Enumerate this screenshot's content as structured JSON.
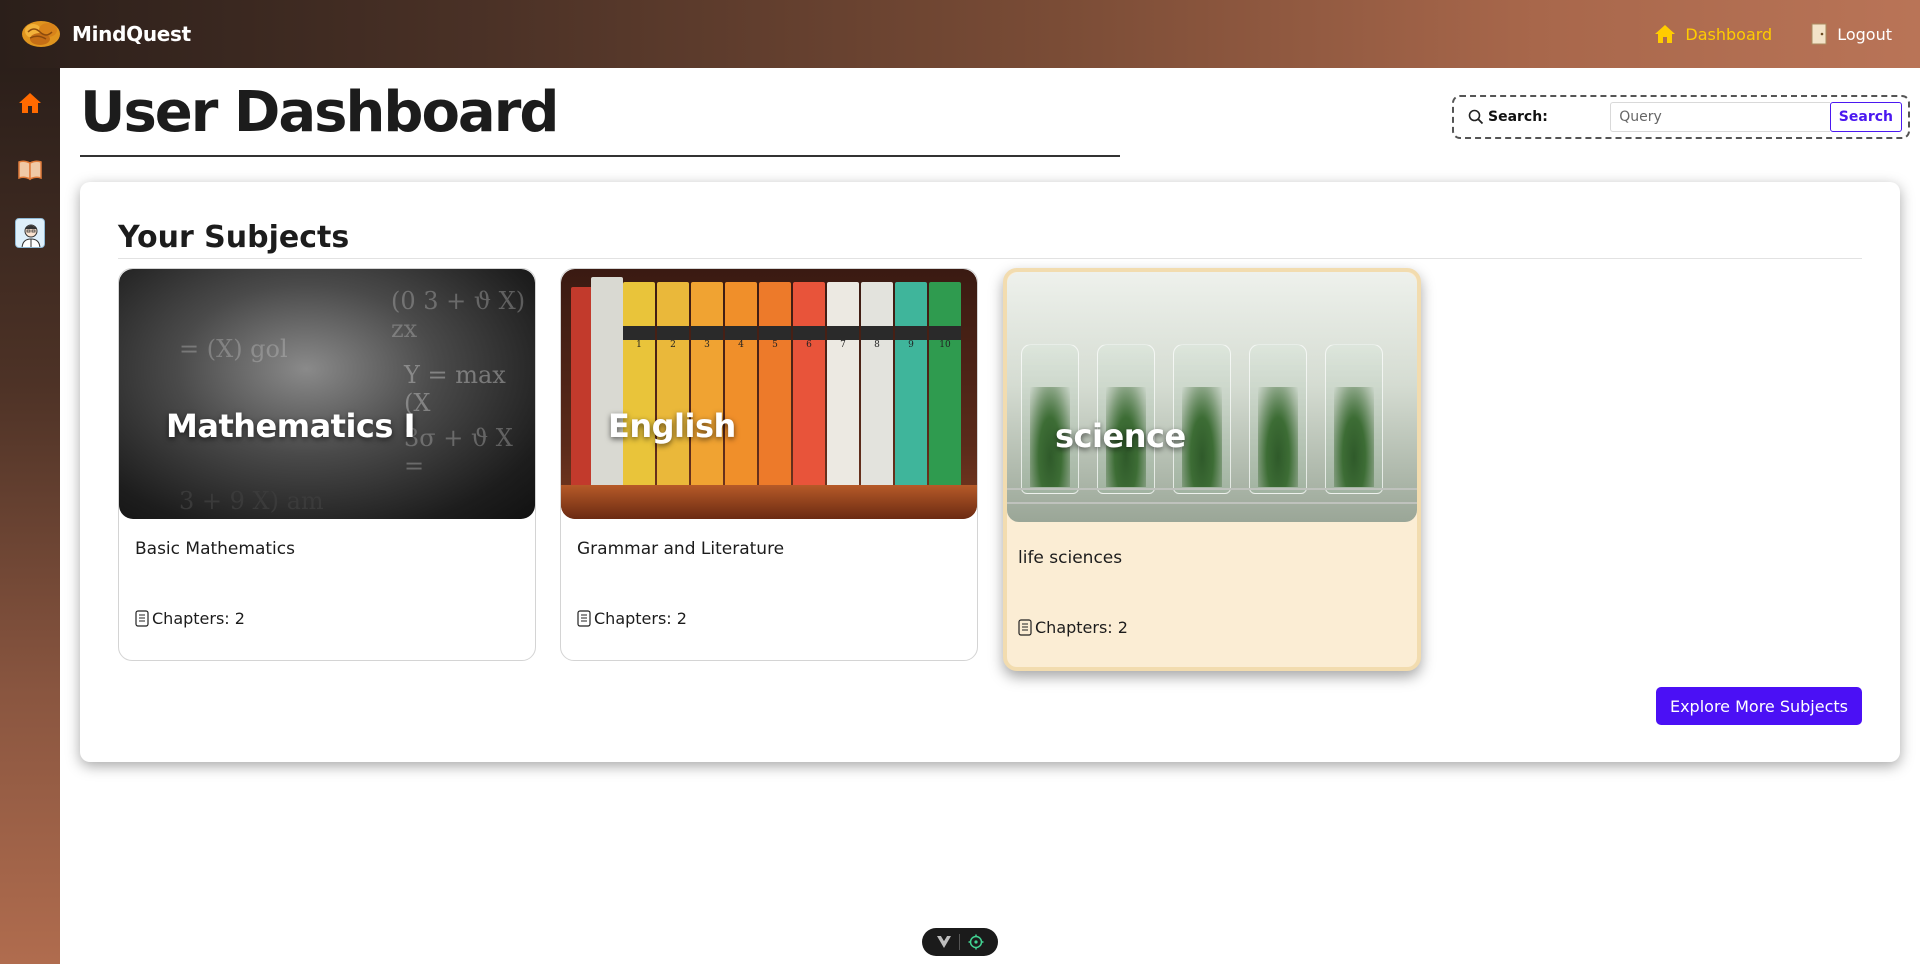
{
  "brand": {
    "name": "MindQuest"
  },
  "nav": {
    "dashboard_label": "Dashboard",
    "logout_label": "Logout"
  },
  "header": {
    "title": "User Dashboard"
  },
  "search": {
    "label": "Search:",
    "placeholder": "Query",
    "button_label": "Search"
  },
  "subjects": {
    "heading": "Your Subjects",
    "cards": [
      {
        "title": "Mathematics I",
        "description": "Basic Mathematics",
        "chapters": "Chapters: 2"
      },
      {
        "title": "English",
        "description": "Grammar and Literature",
        "chapters": "Chapters: 2"
      },
      {
        "title": "science",
        "description": "life sciences",
        "chapters": "Chapters: 2"
      }
    ],
    "explore_label": "Explore More Subjects"
  },
  "math_equations": [
    "(0 3 + ϑ X) zx",
    "= (X) gol",
    "Y = max (X",
    "3σ + ϑ X =",
    "3 + 9 X) am"
  ],
  "book_numbers": [
    "1",
    "2",
    "3",
    "4",
    "5",
    "6",
    "7",
    "8",
    "9",
    "10"
  ],
  "colors": {
    "accent": "#4b10f5",
    "active_nav": "#ffcc00",
    "highlight_card": "#fbedd4"
  }
}
